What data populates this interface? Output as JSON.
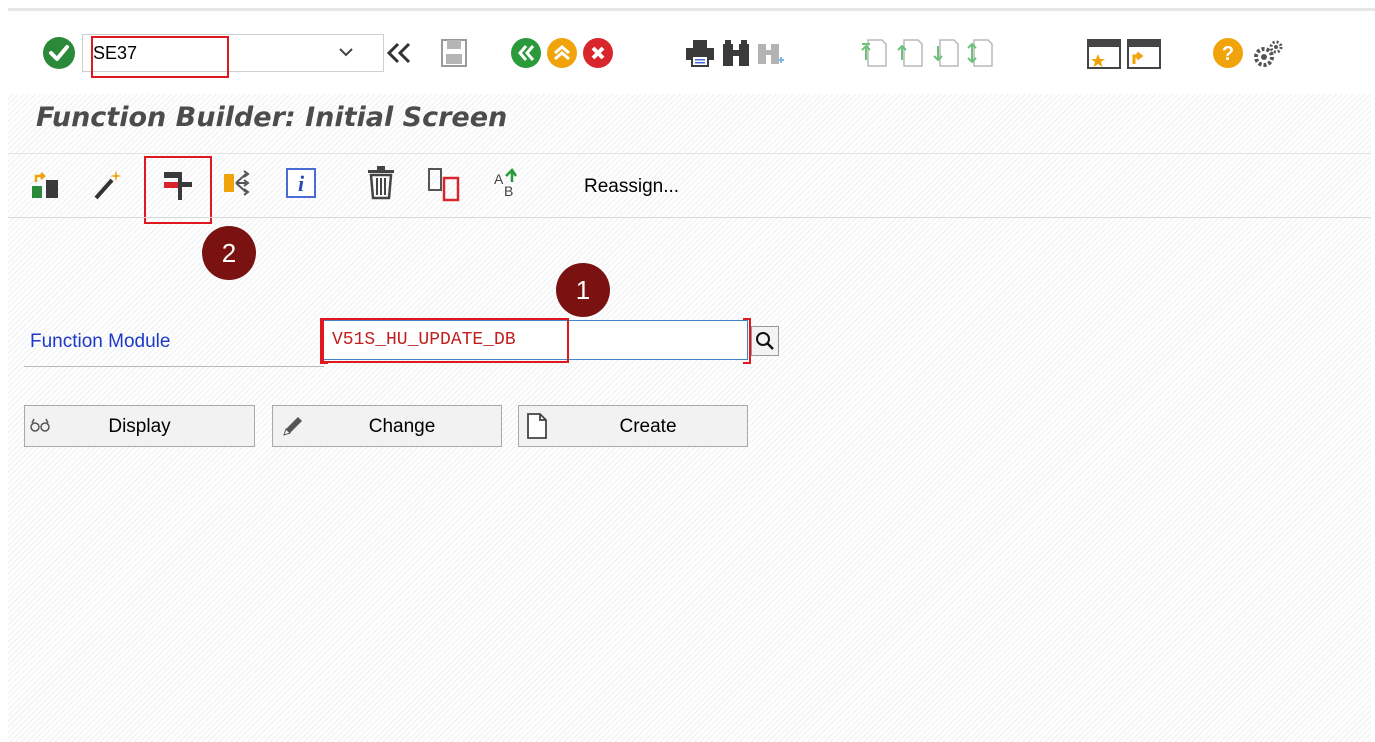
{
  "toolbar": {
    "command_value": "SE37",
    "icons": [
      "enter-icon",
      "command-dropdown-icon",
      "collapse-icon",
      "save-icon",
      "back-icon",
      "exit-icon",
      "cancel-icon",
      "print-icon",
      "find-icon",
      "find-next-icon",
      "first-page-icon",
      "previous-page-icon",
      "next-page-icon",
      "last-page-icon",
      "create-session-icon",
      "shortcut-icon",
      "help-icon",
      "settings-icon"
    ]
  },
  "title": "Function Builder: Initial Screen",
  "app_toolbar": {
    "icons": [
      "other-object-icon",
      "wizard-icon",
      "test-function-icon",
      "where-used-icon",
      "info-icon",
      "delete-icon",
      "copy-icon",
      "rename-icon"
    ],
    "reassign_label": "Reassign..."
  },
  "annotations": {
    "badge1": "1",
    "badge2": "2"
  },
  "form": {
    "function_module_label": "Function Module",
    "function_module_value": "V51S_HU_UPDATE_DB"
  },
  "buttons": {
    "display": "Display",
    "change": "Change",
    "create": "Create"
  },
  "colors": {
    "highlight": "#e0181f",
    "badge": "#7a1212",
    "label_blue": "#1d39c9",
    "value_red": "#c0201f",
    "enter_green": "#2a8a39",
    "nav_green": "#2a9a3a",
    "nav_orange": "#f0a30a",
    "cancel_red": "#d9252c"
  }
}
